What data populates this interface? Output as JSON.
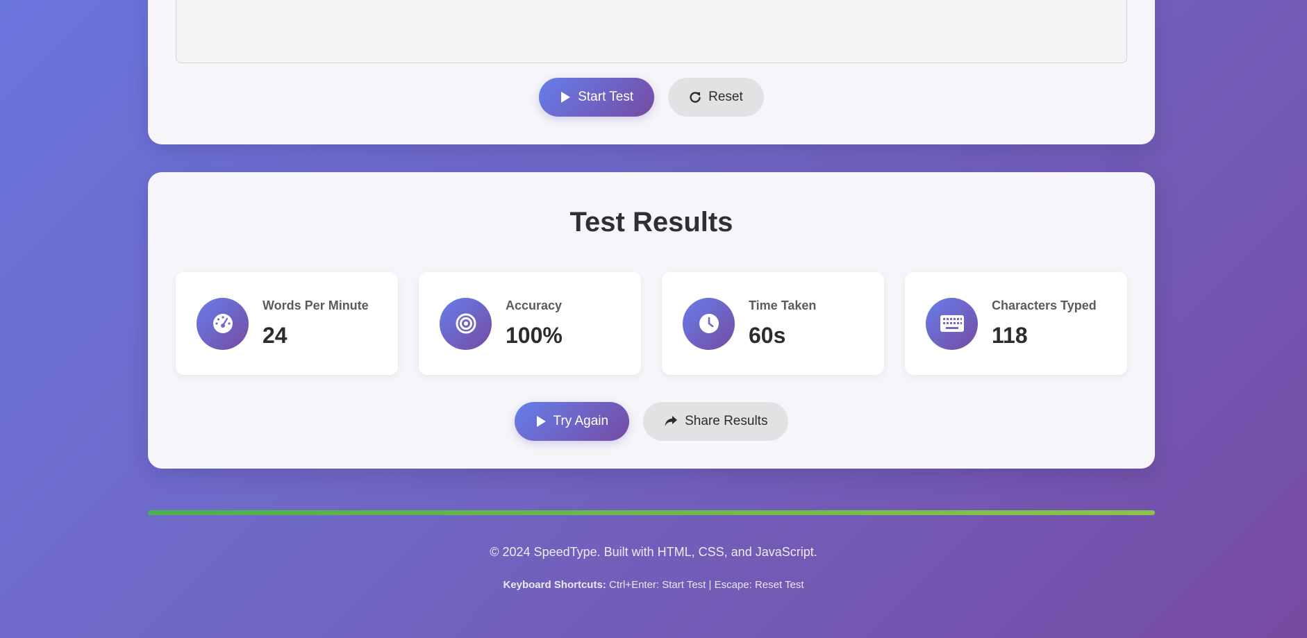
{
  "test_controls": {
    "start_label": "Start Test",
    "reset_label": "Reset"
  },
  "results": {
    "title": "Test Results",
    "stats": [
      {
        "label": "Words Per Minute",
        "value": "24",
        "icon": "speedometer-icon"
      },
      {
        "label": "Accuracy",
        "value": "100%",
        "icon": "target-icon"
      },
      {
        "label": "Time Taken",
        "value": "60s",
        "icon": "clock-icon"
      },
      {
        "label": "Characters Typed",
        "value": "118",
        "icon": "keyboard-icon"
      }
    ],
    "try_again_label": "Try Again",
    "share_label": "Share Results"
  },
  "progress": {
    "value": 1.0,
    "color": "#4caf50"
  },
  "footer": {
    "copyright": "© 2024 SpeedType. Built with HTML, CSS, and JavaScript.",
    "shortcuts_label": "Keyboard Shortcuts:",
    "shortcuts_text": "Ctrl+Enter: Start Test | Escape: Reset Test"
  },
  "colors": {
    "accent_start": "#667eea",
    "accent_end": "#764ba2",
    "card_bg": "#f6f5f9"
  }
}
